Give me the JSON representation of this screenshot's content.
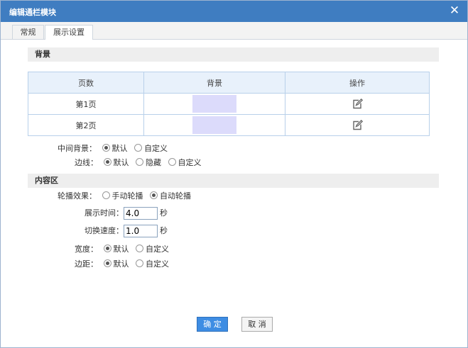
{
  "dialog": {
    "title": "编辑通栏模块",
    "close_icon": "close-icon"
  },
  "tabs": [
    {
      "label": "常规",
      "active": false
    },
    {
      "label": "展示设置",
      "active": true
    }
  ],
  "background_section": {
    "title": "背景",
    "table": {
      "headers": [
        "页数",
        "背景",
        "操作"
      ],
      "rows": [
        {
          "page": "第1页",
          "swatch_color": "#dcdbfb",
          "action_icon": "edit-icon"
        },
        {
          "page": "第2页",
          "swatch_color": "#dcdbfb",
          "action_icon": "edit-icon"
        }
      ]
    },
    "middle_bg": {
      "label": "中间背景：",
      "options": [
        "默认",
        "自定义"
      ],
      "selected": "默认"
    },
    "border": {
      "label": "边线：",
      "options": [
        "默认",
        "隐藏",
        "自定义"
      ],
      "selected": "默认"
    }
  },
  "content_section": {
    "title": "内容区",
    "carousel": {
      "label": "轮播效果：",
      "options": [
        "手动轮播",
        "自动轮播"
      ],
      "selected": "自动轮播"
    },
    "display_time": {
      "label": "展示时间：",
      "value": "4.0",
      "unit": "秒"
    },
    "switch_speed": {
      "label": "切换速度：",
      "value": "1.0",
      "unit": "秒"
    },
    "width": {
      "label": "宽度：",
      "options": [
        "默认",
        "自定义"
      ],
      "selected": "默认"
    },
    "margin": {
      "label": "边距：",
      "options": [
        "默认",
        "自定义"
      ],
      "selected": "默认"
    }
  },
  "footer": {
    "ok_label": "确 定",
    "cancel_label": "取 消"
  },
  "colors": {
    "titlebar": "#3f7dc1",
    "primary_button": "#3e8de3",
    "swatch": "#dcdbfb"
  }
}
